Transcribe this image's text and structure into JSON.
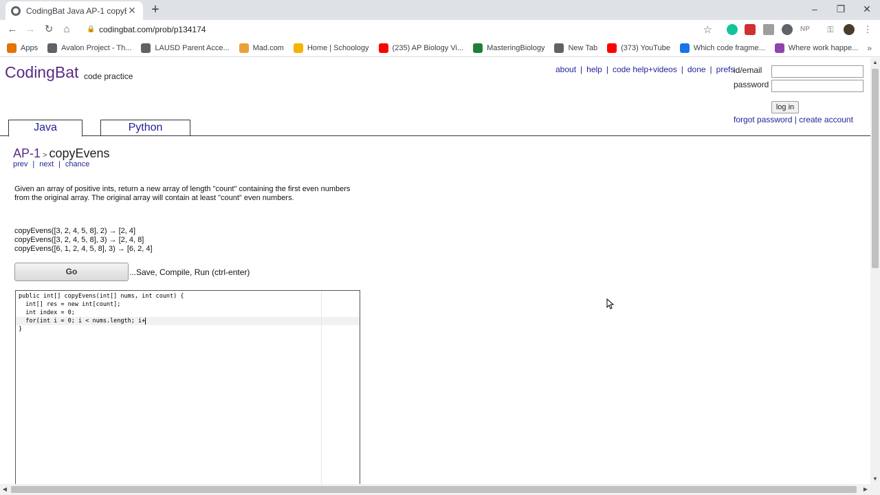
{
  "browser": {
    "tab_title": "CodingBat Java AP-1 copyEvens",
    "url": "codingbat.com/prob/p134174",
    "bookmarks": [
      {
        "label": "Apps",
        "color": "#e37400"
      },
      {
        "label": "Avalon Project - Th...",
        "color": "#5f6368"
      },
      {
        "label": "LAUSD Parent Acce...",
        "color": "#5f6368"
      },
      {
        "label": "Mad.com",
        "color": "#e8a13a"
      },
      {
        "label": "Home | Schoology",
        "color": "#f4b400"
      },
      {
        "label": "(235) AP Biology Vi...",
        "color": "#ff0000"
      },
      {
        "label": "MasteringBiology",
        "color": "#1e7f3a"
      },
      {
        "label": "New Tab",
        "color": "#5f6368"
      },
      {
        "label": "(373) YouTube",
        "color": "#ff0000"
      },
      {
        "label": "Which code fragme...",
        "color": "#1a73e8"
      },
      {
        "label": "Where work happe...",
        "color": "#8e44ad"
      }
    ],
    "more_bookmarks": "»"
  },
  "site": {
    "logo": "CodingBat",
    "logo_sub": "code practice",
    "top_links": [
      "about",
      "help",
      "code help+videos",
      "done",
      "prefs"
    ],
    "login": {
      "id_label": "id/email",
      "password_label": "password",
      "login_button": "log in",
      "forgot": "forgot password",
      "separator": "|",
      "create": "create account"
    },
    "tabs": [
      "Java",
      "Python"
    ]
  },
  "problem": {
    "section": "AP-1",
    "name": "copyEvens",
    "nav": [
      "prev",
      "next",
      "chance"
    ],
    "description": "Given an array of positive ints, return a new array of length \"count\" containing the first even numbers from the original array. The original array will contain at least \"count\" even numbers.",
    "examples": [
      "copyEvens([3, 2, 4, 5, 8], 2) → [2, 4]",
      "copyEvens([3, 2, 4, 5, 8], 3) → [2, 4, 8]",
      "copyEvens([6, 1, 2, 4, 5, 8], 3) → [6, 2, 4]"
    ],
    "go_button": "Go",
    "go_hint": "...Save, Compile, Run (ctrl-enter)"
  },
  "editor": {
    "lines": [
      "public int[] copyEvens(int[] nums, int count) {",
      "  int[] res = new int[count];",
      "  int index = 0;",
      "  for(int i = 0; i < nums.length; i+",
      "}"
    ]
  }
}
